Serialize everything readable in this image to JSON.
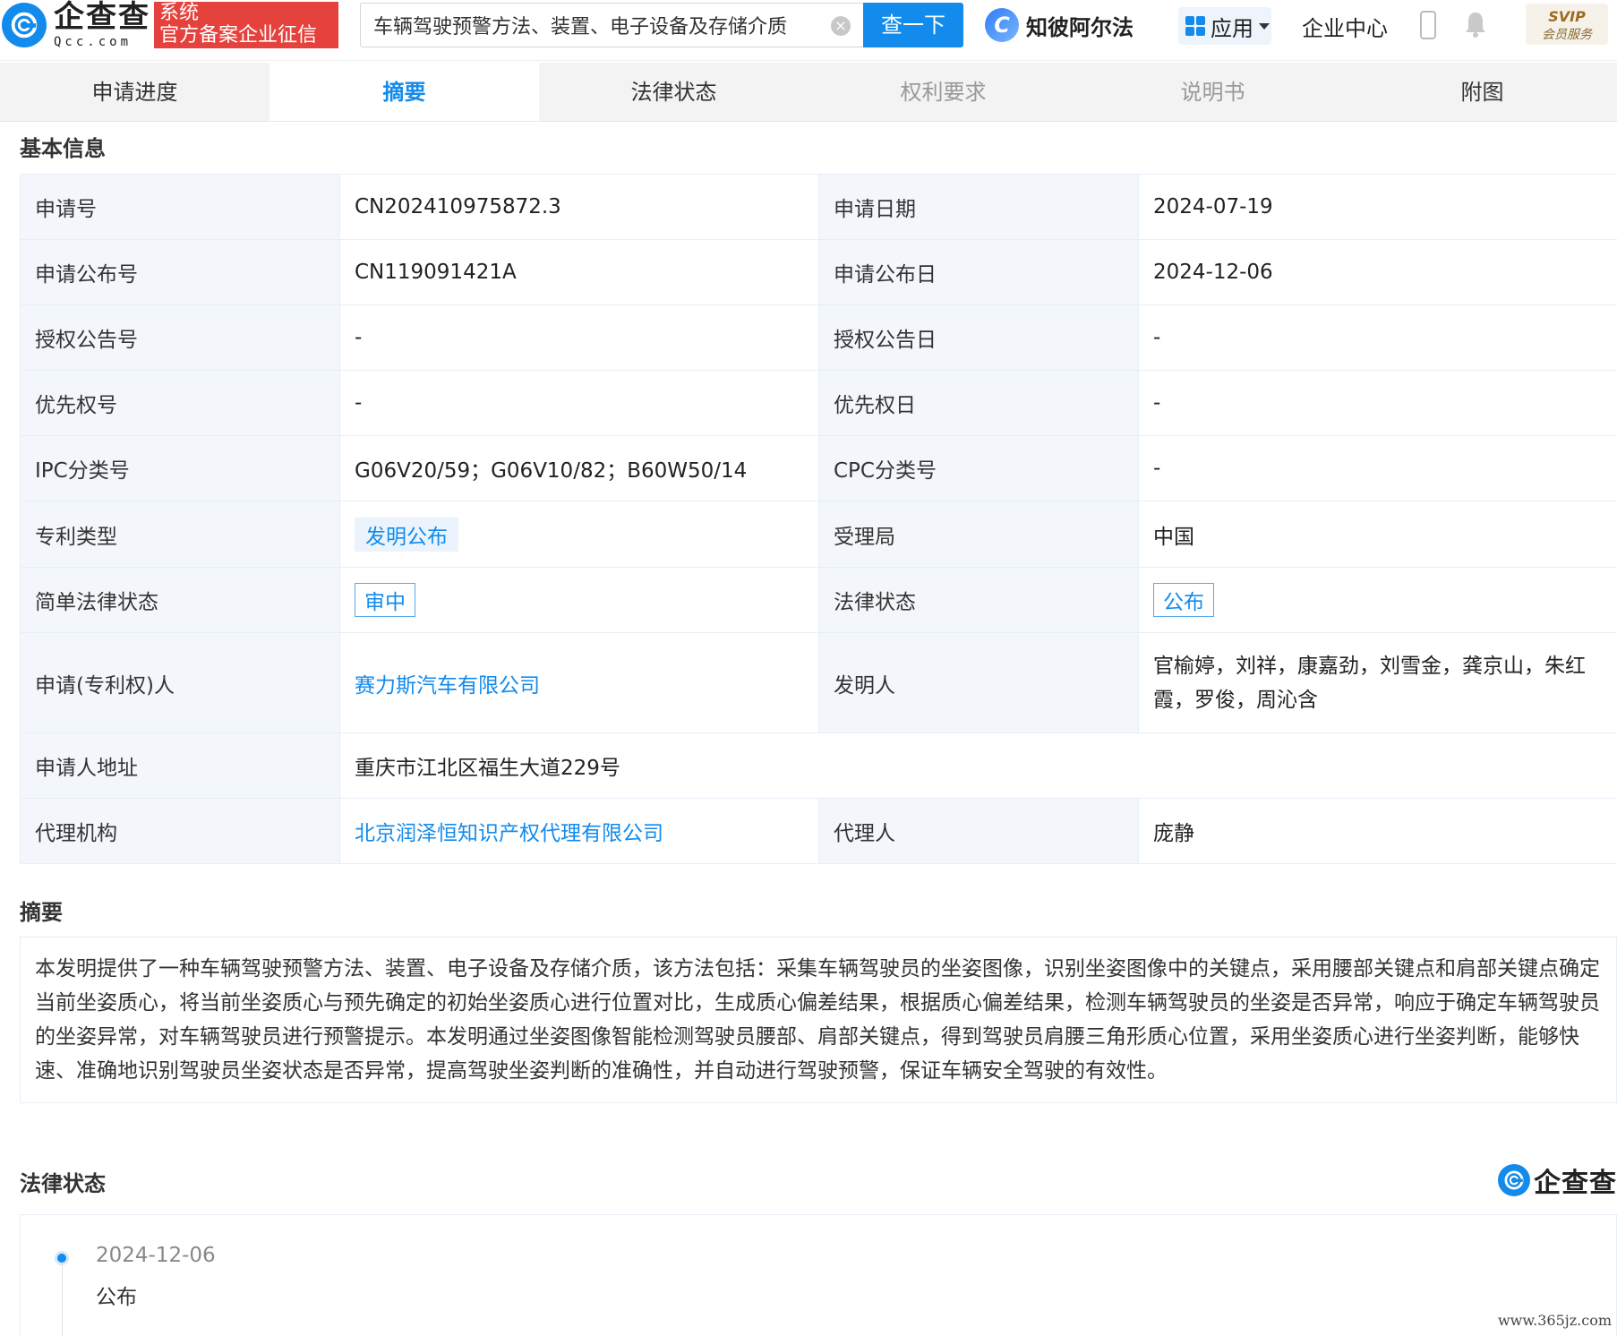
{
  "header": {
    "logo_cn": "企查查",
    "logo_en": "Qcc.com",
    "badge_line1": "系统",
    "badge_line2": "官方备案企业征信",
    "search_value": "车辆驾驶预警方法、装置、电子设备及存储介质",
    "search_button": "查一下",
    "ai_label": "知彼阿尔法",
    "apps_label": "应用",
    "enterprise_center": "企业中心",
    "svip_top": "SVIP",
    "svip_bottom": "会员服务"
  },
  "tabs": [
    {
      "label": "申请进度",
      "state": "normal"
    },
    {
      "label": "摘要",
      "state": "active"
    },
    {
      "label": "法律状态",
      "state": "normal"
    },
    {
      "label": "权利要求",
      "state": "disabled"
    },
    {
      "label": "说明书",
      "state": "disabled"
    },
    {
      "label": "附图",
      "state": "normal"
    }
  ],
  "basic_info": {
    "title": "基本信息",
    "rows": [
      {
        "l1": "申请号",
        "v1": "CN202410975872.3",
        "l2": "申请日期",
        "v2": "2024-07-19"
      },
      {
        "l1": "申请公布号",
        "v1": "CN119091421A",
        "l2": "申请公布日",
        "v2": "2024-12-06"
      },
      {
        "l1": "授权公告号",
        "v1": "-",
        "l2": "授权公告日",
        "v2": "-"
      },
      {
        "l1": "优先权号",
        "v1": "-",
        "l2": "优先权日",
        "v2": "-"
      },
      {
        "l1": "IPC分类号",
        "v1": "G06V20/59；G06V10/82；B60W50/14",
        "l2": "CPC分类号",
        "v2": "-"
      },
      {
        "l1": "专利类型",
        "v1": "发明公布",
        "l2": "受理局",
        "v2": "中国"
      },
      {
        "l1": "简单法律状态",
        "v1": "审中",
        "l2": "法律状态",
        "v2": "公布"
      },
      {
        "l1": "申请(专利权)人",
        "v1": "赛力斯汽车有限公司",
        "l2": "发明人",
        "v2": "官榆婷，刘祥，康嘉劲，刘雪金，龚京山，朱红霞，罗俊，周沁含"
      },
      {
        "l1": "申请人地址",
        "v1": "重庆市江北区福生大道229号"
      },
      {
        "l1": "代理机构",
        "v1": "北京润泽恒知识产权代理有限公司",
        "l2": "代理人",
        "v2": "庞静"
      }
    ]
  },
  "abstract": {
    "title": "摘要",
    "text": "本发明提供了一种车辆驾驶预警方法、装置、电子设备及存储介质，该方法包括：采集车辆驾驶员的坐姿图像，识别坐姿图像中的关键点，采用腰部关键点和肩部关键点确定当前坐姿质心，将当前坐姿质心与预先确定的初始坐姿质心进行位置对比，生成质心偏差结果，根据质心偏差结果，检测车辆驾驶员的坐姿是否异常，响应于确定车辆驾驶员的坐姿异常，对车辆驾驶员进行预警提示。本发明通过坐姿图像智能检测驾驶员腰部、肩部关键点，得到驾驶员肩腰三角形质心位置，采用坐姿质心进行坐姿判断，能够快速、准确地识别驾驶员坐姿状态是否异常，提高驾驶坐姿判断的准确性，并自动进行驾驶预警，保证车辆安全驾驶的有效性。"
  },
  "legal_status": {
    "title": "法律状态",
    "watermark_logo": "企查查",
    "events": [
      {
        "date": "2024-12-06",
        "status": "公布"
      }
    ]
  },
  "watermark_url": "www.365jz.com",
  "colors": {
    "brand_blue": "#128bed",
    "badge_red": "#e5423d",
    "label_bg": "#f3f7fc"
  }
}
